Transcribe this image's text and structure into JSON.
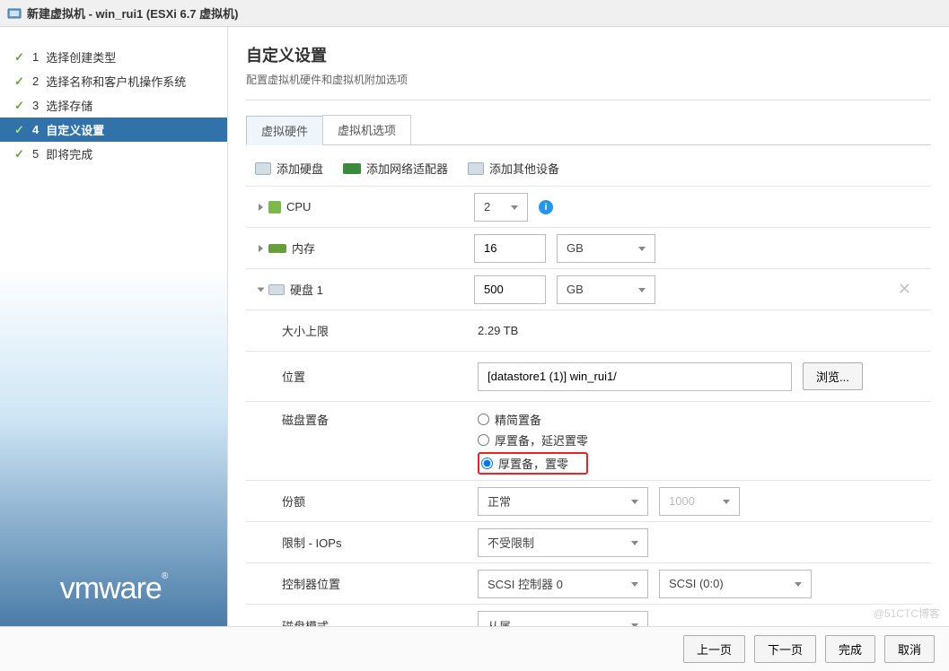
{
  "titlebar": {
    "title": "新建虚拟机 - win_rui1 (ESXi 6.7 虚拟机)"
  },
  "sidebar": {
    "steps": [
      {
        "num": "1",
        "label": "选择创建类型"
      },
      {
        "num": "2",
        "label": "选择名称和客户机操作系统"
      },
      {
        "num": "3",
        "label": "选择存储"
      },
      {
        "num": "4",
        "label": "自定义设置"
      },
      {
        "num": "5",
        "label": "即将完成"
      }
    ],
    "logo": "vmware"
  },
  "content": {
    "title": "自定义设置",
    "subtitle": "配置虚拟机硬件和虚拟机附加选项",
    "tabs": [
      {
        "label": "虚拟硬件",
        "active": true
      },
      {
        "label": "虚拟机选项",
        "active": false
      }
    ],
    "addbar": {
      "add_disk": "添加硬盘",
      "add_nic": "添加网络适配器",
      "add_other": "添加其他设备"
    },
    "rows": {
      "cpu": {
        "label": "CPU",
        "value": "2"
      },
      "memory": {
        "label": "内存",
        "value": "16",
        "unit": "GB"
      },
      "disk": {
        "label": "硬盘 1",
        "value": "500",
        "unit": "GB"
      },
      "max_size": {
        "label": "大小上限",
        "value": "2.29 TB"
      },
      "location": {
        "label": "位置",
        "value": "[datastore1 (1)] win_rui1/",
        "browse": "浏览..."
      },
      "provisioning": {
        "label": "磁盘置备",
        "options": [
          "精简置备",
          "厚置备，延迟置零",
          "厚置备，置零"
        ],
        "selected": 2
      },
      "shares": {
        "label": "份额",
        "value": "正常",
        "secondary": "1000"
      },
      "limit": {
        "label": "限制 - IOPs",
        "value": "不受限制"
      },
      "ctrl_loc": {
        "label": "控制器位置",
        "value": "SCSI 控制器 0",
        "secondary": "SCSI (0:0)"
      },
      "disk_mode": {
        "label": "磁盘模式",
        "value": "从属"
      }
    }
  },
  "footer": {
    "prev": "上一页",
    "next": "下一页",
    "finish": "完成",
    "cancel": "取消"
  },
  "watermark": "@51CTC博客"
}
